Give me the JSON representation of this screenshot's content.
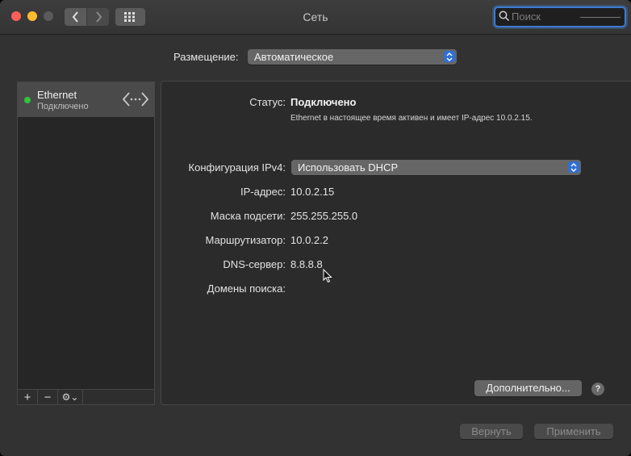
{
  "window": {
    "title": "Сеть"
  },
  "search": {
    "placeholder": "Поиск"
  },
  "location": {
    "label": "Размещение:",
    "value": "Автоматическое"
  },
  "services": [
    {
      "name": "Ethernet",
      "status": "Подключено",
      "status_color": "#30c440"
    }
  ],
  "sidebar_tools": {
    "add": "+",
    "remove": "−",
    "gear": "⚙⌄"
  },
  "details": {
    "status_label": "Статус:",
    "status_value": "Подключено",
    "status_description": "Ethernet в настоящее время активен и имеет IP-адрес 10.0.2.15.",
    "ipv4_config_label": "Конфигурация IPv4:",
    "ipv4_config_value": "Использовать DHCP",
    "ip_label": "IP-адрес:",
    "ip_value": "10.0.2.15",
    "subnet_label": "Маска подсети:",
    "subnet_value": "255.255.255.0",
    "router_label": "Маршрутизатор:",
    "router_value": "10.0.2.2",
    "dns_label": "DNS-сервер:",
    "dns_value": "8.8.8.8",
    "search_domains_label": "Домены поиска:",
    "search_domains_value": ""
  },
  "buttons": {
    "advanced": "Дополнительно...",
    "help": "?",
    "revert": "Вернуть",
    "apply": "Применить"
  },
  "colors": {
    "accent": "#2f6fd4",
    "connected": "#30c440"
  }
}
